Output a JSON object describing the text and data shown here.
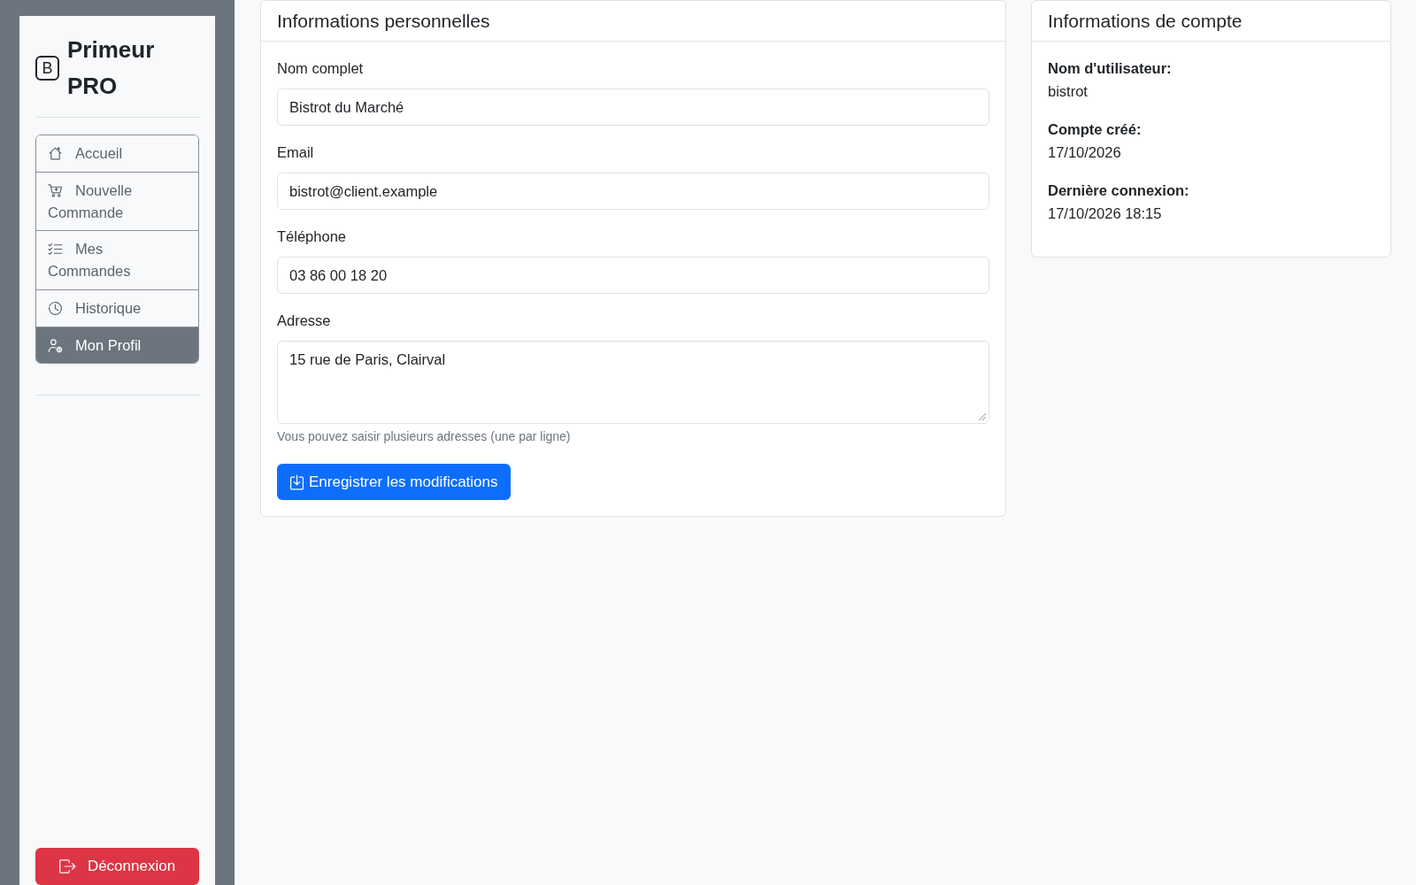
{
  "sidebar": {
    "brand": {
      "logo": "B",
      "name": "Primeur PRO"
    },
    "nav": [
      {
        "label": "Accueil",
        "selected": false
      },
      {
        "label": "Nouvelle Commande",
        "selected": false
      },
      {
        "label": "Mes Commandes",
        "selected": false
      },
      {
        "label": "Historique",
        "selected": false
      },
      {
        "label": "Mon Profil",
        "selected": true
      }
    ],
    "logout_button": "Déconnexion"
  },
  "personal_info": {
    "title": "Informations personnelles",
    "fields": [
      {
        "kind": "input",
        "label": "Nom complet",
        "value": "Bistrot du Marché"
      },
      {
        "kind": "input",
        "label": "Email",
        "value": "bistrot@client.example"
      },
      {
        "kind": "input",
        "label": "Téléphone",
        "value": "03 86 00 18 20"
      },
      {
        "kind": "textarea",
        "label": "Adresse",
        "value": "15 rue de Paris, Clairval",
        "help": "Vous pouvez saisir plusieurs adresses (une par ligne)"
      }
    ],
    "save_button": "Enregistrer les modifications"
  },
  "account_info": {
    "title": "Informations de compte",
    "items": [
      {
        "label": "Nom d'utilisateur:",
        "value": "bistrot"
      },
      {
        "label": "Compte créé:",
        "value": "17/10/2026"
      },
      {
        "label": "Dernière connexion:",
        "value": "17/10/2026 18:15"
      }
    ]
  }
}
